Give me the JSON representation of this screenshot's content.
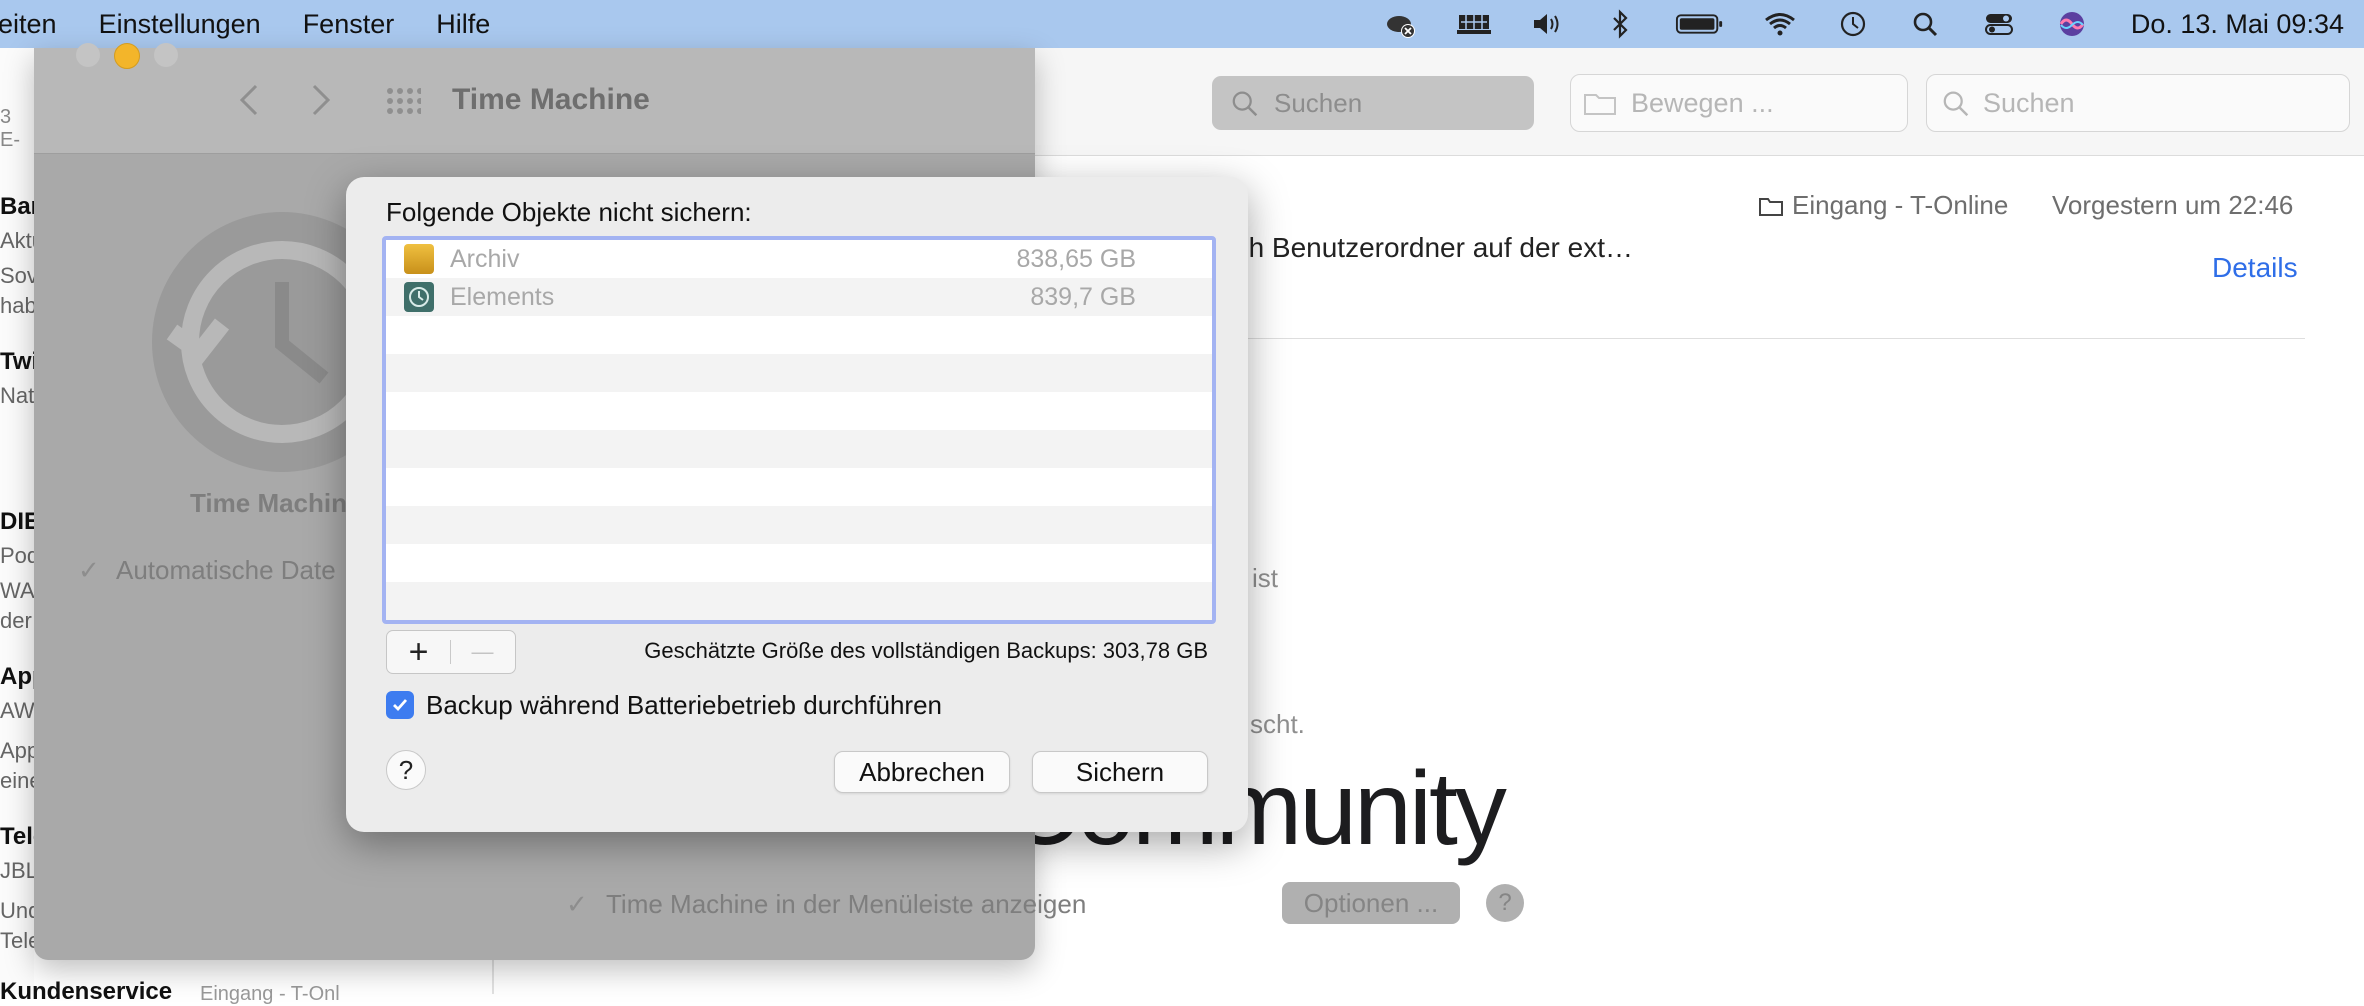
{
  "menubar": {
    "items": [
      "eiten",
      "Einstellungen",
      "Fenster",
      "Hilfe"
    ],
    "date_time": "Do. 13. Mai  09:34",
    "icons": [
      "icloud-error-icon",
      "display-icon",
      "volume-icon",
      "bluetooth-icon",
      "battery-icon",
      "wifi-icon",
      "time-machine-icon",
      "spotlight-icon",
      "control-center-icon",
      "siri-icon"
    ]
  },
  "mail": {
    "move_placeholder": "Bewegen ...",
    "search_placeholder": "Suchen",
    "mailbox": "Eingang - T-Online",
    "date": "Vorgestern um 22:46",
    "snippet": "achten, wenn sich Benutzerordner auf der ext…",
    "details": "Details",
    "community_text": "Community",
    "left_fragments": [
      {
        "bold": "Bar",
        "lines": [
          "Aktu",
          "Sov",
          "hab"
        ]
      },
      {
        "bold": "Twi",
        "lines": [
          "Nat"
        ]
      },
      {
        "bold": "DIE",
        "lines": [
          "Pod",
          "WAS",
          "der"
        ]
      },
      {
        "bold": "App",
        "lines": [
          "AW:",
          "App",
          "eine"
        ]
      },
      {
        "bold": "Tele",
        "lines": [
          "JBL",
          "Und",
          "Tele"
        ]
      }
    ],
    "bottom_fragment": "Kundenservice",
    "bottom_fragment_2": "Eingang - T-Onl",
    "top_fragment": "3 E-"
  },
  "sysprefs": {
    "title": "Time Machine",
    "search_placeholder": "Suchen",
    "app_label": "Time Machin",
    "auto_backup_label": "Automatische Date",
    "show_in_menubar": "Time Machine in der Menüleiste anzeigen",
    "options_button": "Optionen ...",
    "help": "?",
    "right_fragment_1": "ist",
    "right_fragment_2": "scht."
  },
  "sheet": {
    "heading": "Folgende Objekte nicht sichern:",
    "items": [
      {
        "name": "Archiv",
        "size": "838,65 GB",
        "icon": "external-drive-icon"
      },
      {
        "name": "Elements",
        "size": "839,7 GB",
        "icon": "time-machine-drive-icon"
      }
    ],
    "add_label": "+",
    "remove_label": "—",
    "estimate": "Geschätzte Größe des vollständigen Backups: 303,78 GB",
    "battery_backup_label": "Backup während Batteriebetrieb durchführen",
    "battery_backup_checked": true,
    "help_label": "?",
    "cancel_label": "Abbrechen",
    "save_label": "Sichern"
  }
}
